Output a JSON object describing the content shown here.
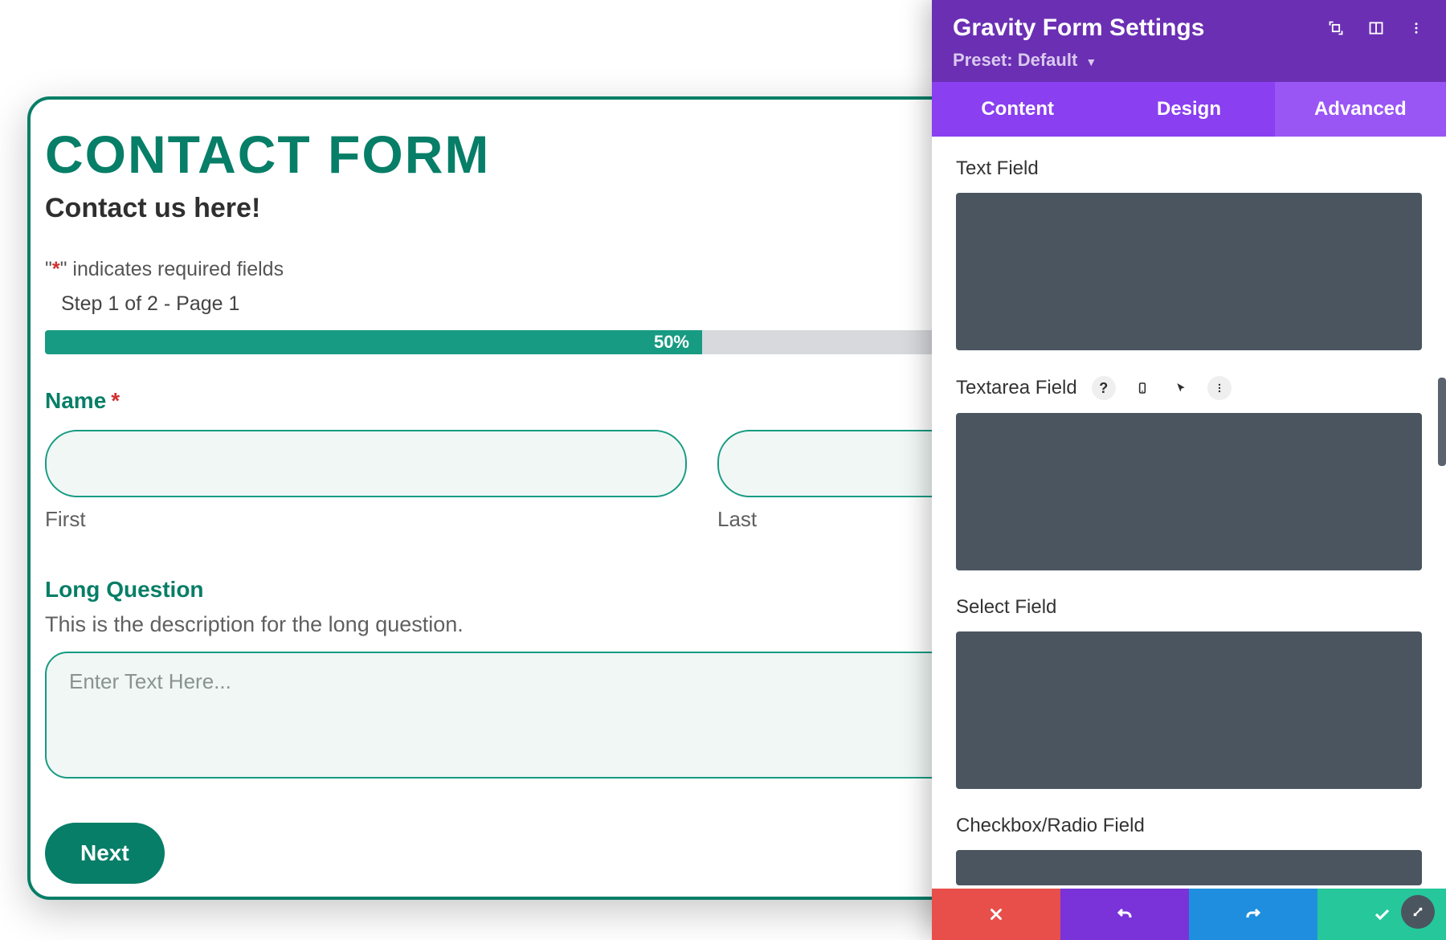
{
  "form": {
    "title": "CONTACT FORM",
    "subtitle": "Contact us here!",
    "required_note_prefix": "\"",
    "required_note_star": "*",
    "required_note_suffix": "\" indicates required fields",
    "step_label": "Step 1 of 2 - Page 1",
    "progress_percent": 50,
    "progress_text": "50%",
    "name": {
      "label": "Name",
      "required_marker": "*",
      "first_sub": "First",
      "last_sub": "Last",
      "first_value": "",
      "last_value": ""
    },
    "long_question": {
      "label": "Long Question",
      "description": "This is the description for the long question.",
      "placeholder": "Enter Text Here...",
      "value": ""
    },
    "next_label": "Next"
  },
  "panel": {
    "title": "Gravity Form Settings",
    "preset_label": "Preset: Default",
    "tabs": [
      {
        "label": "Content",
        "active": false
      },
      {
        "label": "Design",
        "active": false
      },
      {
        "label": "Advanced",
        "active": true
      }
    ],
    "settings": [
      {
        "label": "Text Field"
      },
      {
        "label": "Textarea Field",
        "show_icons": true
      },
      {
        "label": "Select Field"
      },
      {
        "label": "Checkbox/Radio Field",
        "short": true
      }
    ],
    "icons": {
      "expand": "expand-icon",
      "columns": "columns-icon",
      "kebab": "kebab-icon",
      "help": "?",
      "mobile": "mobile-icon",
      "cursor": "cursor-icon",
      "vkebab": "vkebab-icon"
    },
    "footer": {
      "cancel": "close-icon",
      "undo": "undo-icon",
      "redo": "redo-icon",
      "save": "check-icon"
    }
  },
  "colors": {
    "teal": "#077e67",
    "teal_light": "#179b82",
    "purple_header": "#6b2fb3",
    "purple_tabs": "#8a3ff0",
    "purple_tab_active": "#9a56f5",
    "code_box": "#4a5560",
    "footer_red": "#e84f4b",
    "footer_purple": "#7a33d8",
    "footer_blue": "#1f8ede",
    "footer_green": "#25c79b"
  }
}
